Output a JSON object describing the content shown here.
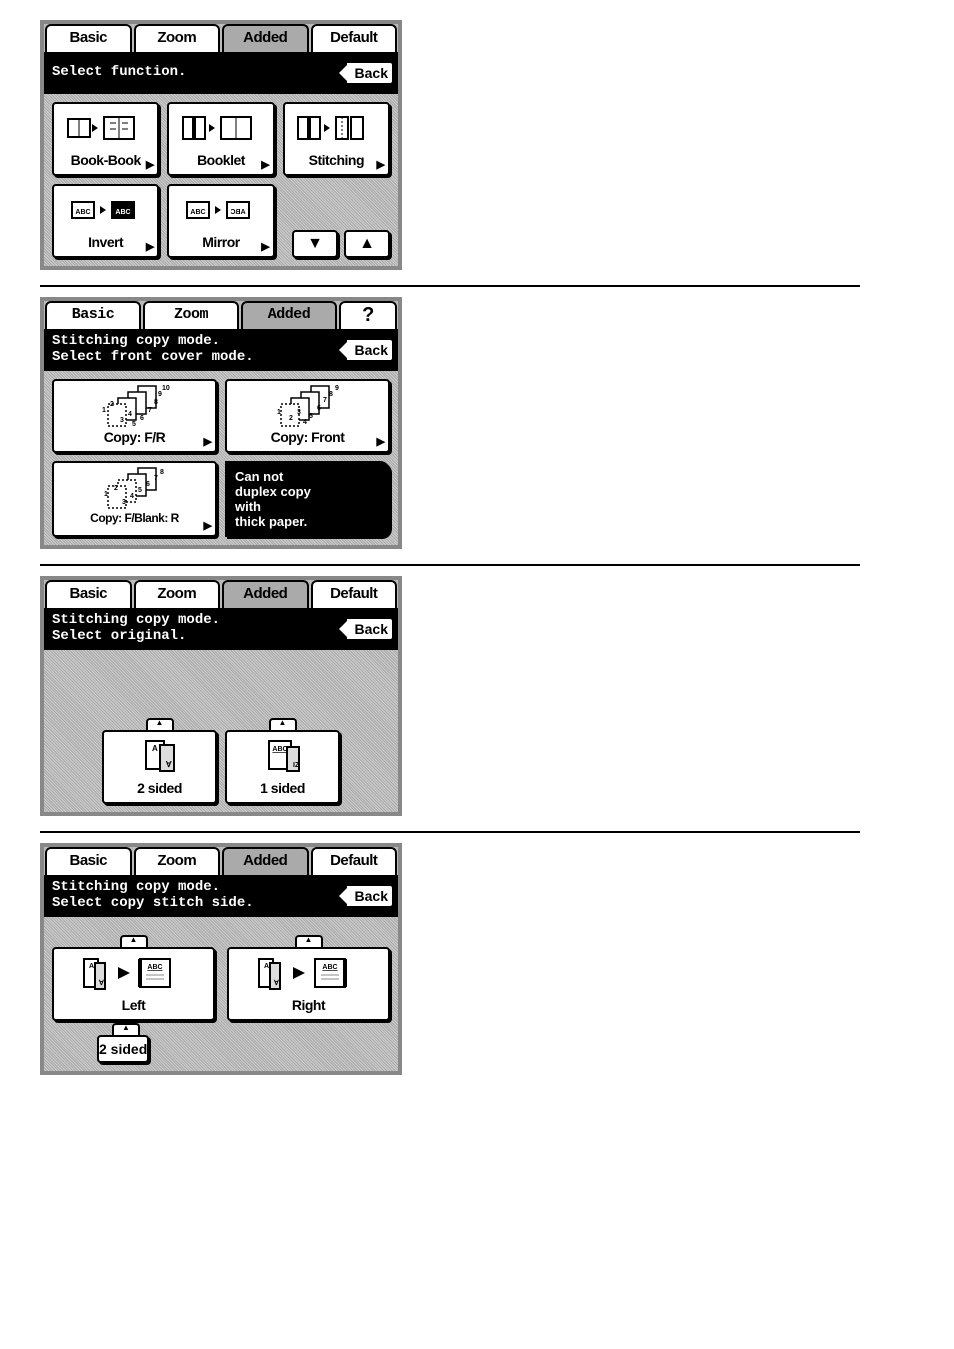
{
  "tabs": {
    "basic": "Basic",
    "zoom": "Zoom",
    "added": "Added",
    "default": "Default",
    "help": "?"
  },
  "back_label": "Back",
  "panel1": {
    "msg1": "Select function.",
    "btn_book_book": "Book-Book",
    "btn_booklet": "Booklet",
    "btn_stitching": "Stitching",
    "btn_invert": "Invert",
    "btn_mirror": "Mirror"
  },
  "panel2": {
    "msg1": "Stitching copy mode.",
    "msg2": "Select front cover mode.",
    "btn_copy_fr": "Copy: F/R",
    "btn_copy_front": "Copy: Front",
    "btn_copy_fblank_r": "Copy: F/Blank: R",
    "note_l1": "Can not",
    "note_l2": "duplex copy",
    "note_l3": "with",
    "note_l4": "thick paper."
  },
  "panel3": {
    "msg1": "Stitching copy mode.",
    "msg2": "Select original.",
    "btn_2sided": "2 sided",
    "btn_1sided": "1 sided"
  },
  "panel4": {
    "msg1": "Stitching copy mode.",
    "msg2": "Select copy stitch side.",
    "btn_left": "Left",
    "btn_right": "Right",
    "footer_2sided": "2 sided"
  }
}
